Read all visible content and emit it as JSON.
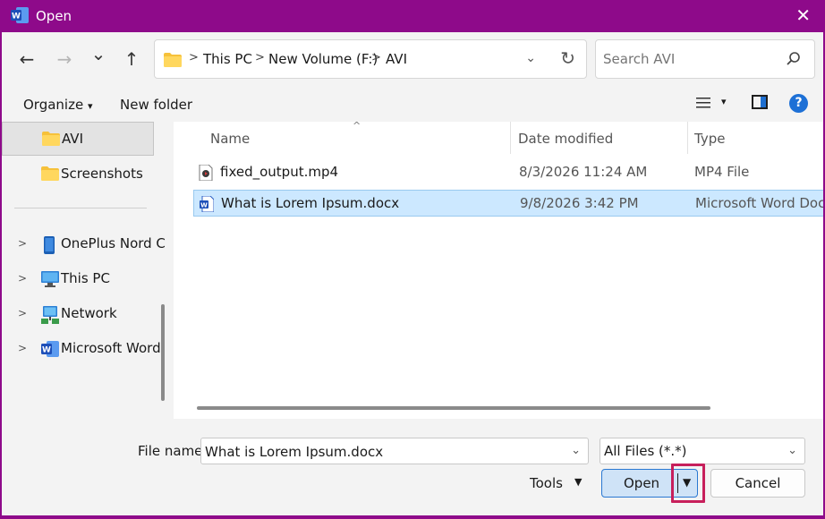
{
  "window": {
    "title": "Open",
    "app_icon": "word-app-icon",
    "close_glyph": "✕"
  },
  "nav": {
    "back_glyph": "←",
    "forward_glyph": "→",
    "recent_glyph": "⌄",
    "up_glyph": "↑",
    "breadcrumbs": [
      "This PC",
      "New Volume (F:)",
      "AVI"
    ],
    "sep_glyph": ">",
    "refresh_glyph": "↻",
    "dropdown_glyph": "⌄"
  },
  "search": {
    "placeholder": "Search AVI"
  },
  "toolbar": {
    "organize_label": "Organize",
    "organize_caret": "▾",
    "new_folder_label": "New folder",
    "view_caret": "▾",
    "help_glyph": "?"
  },
  "sidebar": {
    "items": [
      {
        "label": "AVI",
        "icon": "folder-icon",
        "selected": true,
        "expandable": false
      },
      {
        "label": "Screenshots",
        "icon": "folder-icon",
        "selected": false,
        "expandable": false
      },
      {
        "label": "OnePlus Nord C",
        "icon": "phone-icon",
        "selected": false,
        "expandable": true
      },
      {
        "label": "This PC",
        "icon": "monitor-icon",
        "selected": false,
        "expandable": true
      },
      {
        "label": "Network",
        "icon": "network-icon",
        "selected": false,
        "expandable": true
      },
      {
        "label": "Microsoft Word",
        "icon": "word-icon",
        "selected": false,
        "expandable": true
      }
    ],
    "chevron_glyph": ">"
  },
  "files": {
    "columns": [
      "Name",
      "Date modified",
      "Type"
    ],
    "sort_glyph": "^",
    "rows": [
      {
        "name": "fixed_output.mp4",
        "date": "8/3/2026 11:24 AM",
        "type": "MP4 File",
        "icon": "video-file-icon",
        "selected": false
      },
      {
        "name": "What is Lorem Ipsum.docx",
        "date": "9/8/2026 3:42 PM",
        "type": "Microsoft Word Doc...",
        "icon": "word-document-icon",
        "selected": true
      }
    ]
  },
  "footer": {
    "file_name_label": "File name:",
    "file_name_value": "What is Lorem Ipsum.docx",
    "file_type_value": "All Files (*.*)",
    "dropdown_glyph": "⌄",
    "tools_label": "Tools",
    "tools_caret": "▼",
    "open_label": "Open",
    "open_arrow": "▼",
    "cancel_label": "Cancel"
  },
  "colors": {
    "title_bar": "#8e0a8a",
    "selection": "#cce8ff",
    "primary_button": "#cfe3f7",
    "highlight": "#c71f5b"
  }
}
